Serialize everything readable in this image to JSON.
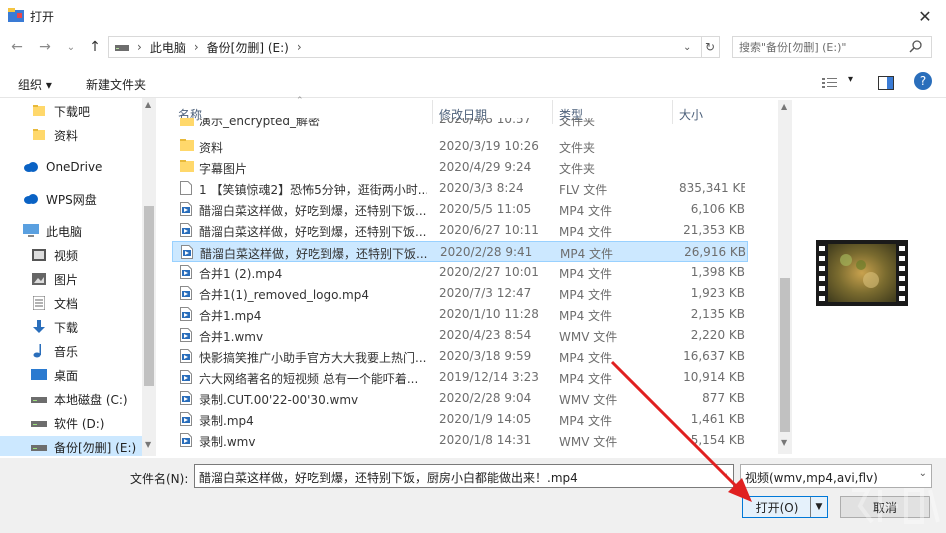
{
  "window": {
    "title": "打开",
    "close_glyph": "✕"
  },
  "address": {
    "breadcrumbs": [
      "此电脑",
      "备份[勿删] (E:)"
    ],
    "search_placeholder": "搜索\"备份[勿删] (E:)\""
  },
  "toolbar": {
    "organize": "组织 ▾",
    "new_folder": "新建文件夹"
  },
  "nav": {
    "items": [
      {
        "label": "下载吧",
        "icon": "folder-icon"
      },
      {
        "label": "资料",
        "icon": "folder-icon"
      },
      {
        "label": "OneDrive",
        "icon": "cloud-icon"
      },
      {
        "label": "WPS网盘",
        "icon": "cloud-icon"
      },
      {
        "label": "此电脑",
        "icon": "computer-icon"
      },
      {
        "label": "视频",
        "icon": "video-folder-icon"
      },
      {
        "label": "图片",
        "icon": "picture-folder-icon"
      },
      {
        "label": "文档",
        "icon": "document-folder-icon"
      },
      {
        "label": "下载",
        "icon": "download-folder-icon"
      },
      {
        "label": "音乐",
        "icon": "music-folder-icon"
      },
      {
        "label": "桌面",
        "icon": "desktop-folder-icon"
      },
      {
        "label": "本地磁盘 (C:)",
        "icon": "drive-icon"
      },
      {
        "label": "软件 (D:)",
        "icon": "drive-icon"
      },
      {
        "label": "备份[勿删] (E:)",
        "icon": "drive-icon"
      }
    ]
  },
  "columns": {
    "name": "名称",
    "date": "修改日期",
    "type": "类型",
    "size": "大小"
  },
  "files": [
    {
      "name": "演示_encrypted_解密",
      "date": "2020/4/8 10:57",
      "type": "文件夹",
      "size": "",
      "icon": "folder",
      "partial": true
    },
    {
      "name": "资料",
      "date": "2020/3/19 10:26",
      "type": "文件夹",
      "size": "",
      "icon": "folder"
    },
    {
      "name": "字幕图片",
      "date": "2020/4/29 9:24",
      "type": "文件夹",
      "size": "",
      "icon": "folder"
    },
    {
      "name": "1 【笑镇惊魂2】恐怖5分钟，逛街两小时...",
      "date": "2020/3/3 8:24",
      "type": "FLV 文件",
      "size": "835,341 KB",
      "icon": "file"
    },
    {
      "name": "醋溜白菜这样做，好吃到爆，还特别下饭...",
      "date": "2020/5/5 11:05",
      "type": "MP4 文件",
      "size": "6,106 KB",
      "icon": "media"
    },
    {
      "name": "醋溜白菜这样做，好吃到爆，还特别下饭...",
      "date": "2020/6/27 10:11",
      "type": "MP4 文件",
      "size": "21,353 KB",
      "icon": "media"
    },
    {
      "name": "醋溜白菜这样做，好吃到爆，还特别下饭...",
      "date": "2020/2/28 9:41",
      "type": "MP4 文件",
      "size": "26,916 KB",
      "icon": "media",
      "selected": true
    },
    {
      "name": "合并1 (2).mp4",
      "date": "2020/2/27 10:01",
      "type": "MP4 文件",
      "size": "1,398 KB",
      "icon": "media"
    },
    {
      "name": "合并1(1)_removed_logo.mp4",
      "date": "2020/7/3 12:47",
      "type": "MP4 文件",
      "size": "1,923 KB",
      "icon": "media"
    },
    {
      "name": "合并1.mp4",
      "date": "2020/1/10 11:28",
      "type": "MP4 文件",
      "size": "2,135 KB",
      "icon": "media"
    },
    {
      "name": "合并1.wmv",
      "date": "2020/4/23 8:54",
      "type": "WMV 文件",
      "size": "2,220 KB",
      "icon": "media"
    },
    {
      "name": "快影搞笑推广小助手官方大大我要上热门...",
      "date": "2020/3/18 9:59",
      "type": "MP4 文件",
      "size": "16,637 KB",
      "icon": "media"
    },
    {
      "name": "六大网络著名的短视频 总有一个能吓着...",
      "date": "2019/12/14 3:23",
      "type": "MP4 文件",
      "size": "10,914 KB",
      "icon": "media"
    },
    {
      "name": "录制.CUT.00'22-00'30.wmv",
      "date": "2020/2/28 9:04",
      "type": "WMV 文件",
      "size": "877 KB",
      "icon": "media"
    },
    {
      "name": "录制.mp4",
      "date": "2020/1/9 14:05",
      "type": "MP4 文件",
      "size": "1,461 KB",
      "icon": "media"
    },
    {
      "name": "录制.wmv",
      "date": "2020/1/8 14:31",
      "type": "WMV 文件",
      "size": "5,154 KB",
      "icon": "media"
    }
  ],
  "footer": {
    "filename_label": "文件名(N):",
    "filename_value": "醋溜白菜这样做，好吃到爆，还特别下饭，厨房小白都能做出来！.mp4",
    "filter_value": "视频(wmv,mp4,avi,flv)",
    "open_label": "打开(O)",
    "cancel_label": "取消"
  }
}
